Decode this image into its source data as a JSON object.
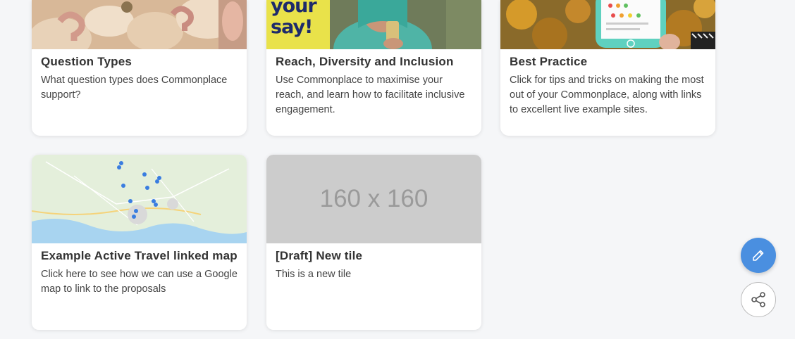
{
  "tiles": [
    {
      "title": "Question Types",
      "description": "What question types does Commonplace support?"
    },
    {
      "title": "Reach, Diversity and Inclusion",
      "description": "Use Commonplace to maximise your reach, and learn how to facilitate inclusive engagement.",
      "image_text": "your say!"
    },
    {
      "title": "Best Practice",
      "description": "Click for tips and tricks on making the most out of your Commonplace, along with links to excellent live example sites."
    },
    {
      "title": "Example Active Travel linked map",
      "description": "Click here to see how we can use a Google map to link to the proposals"
    },
    {
      "title": "[Draft] New tile",
      "description": "This is a new tile",
      "placeholder_text": "160 x 160"
    }
  ],
  "actions": {
    "edit_icon": "pencil-icon",
    "share_icon": "share-icon",
    "edit_color": "#4a8fe0"
  }
}
